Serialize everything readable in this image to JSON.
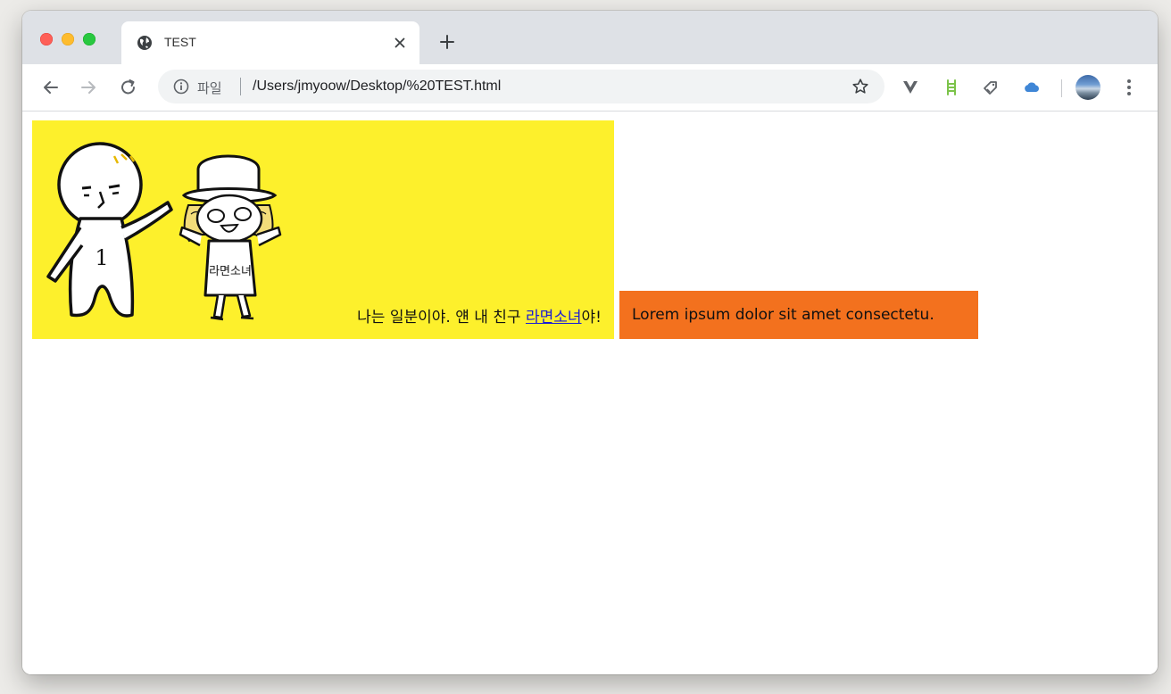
{
  "browser": {
    "tab": {
      "title": "TEST",
      "favicon": "globe-icon"
    },
    "address_bar": {
      "scheme_label": "파일",
      "url": "/Users/jmyoow/Desktop/%20TEST.html"
    },
    "extensions": [
      "v-extension-icon",
      "ladder-extension-icon",
      "tag-extension-icon",
      "cloud-extension-icon"
    ]
  },
  "page": {
    "yellow_box": {
      "text_before": "나는 일분이야. 얜 내 친구 ",
      "link_text": "라면소녀",
      "text_after": "야!",
      "figure_labels": {
        "number": "1",
        "shirt": "라면소녀"
      },
      "color": "#fdf02c"
    },
    "orange_box": {
      "text": "Lorem ipsum dolor sit amet consectetu.",
      "color": "#f3711e"
    }
  }
}
